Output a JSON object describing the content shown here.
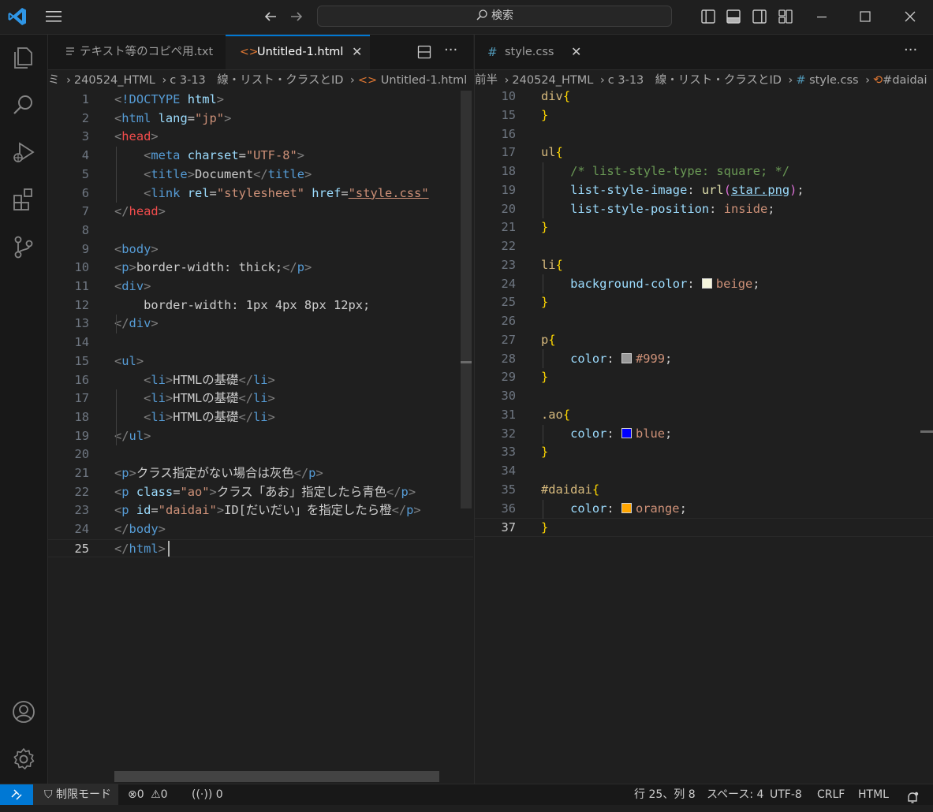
{
  "title_bar": {
    "search_placeholder": "検索"
  },
  "left_editor": {
    "tabs": [
      {
        "label": "テキスト等のコピペ用.txt",
        "active": false
      },
      {
        "label": "Untitled-1.html",
        "active": true
      }
    ],
    "breadcrumb": [
      "240524_HTML",
      "c 3-13　線・リスト・クラスとID",
      "Untitled-1.html",
      "..."
    ],
    "breadcrumb_lead": "ミ",
    "current_line": 25,
    "lines": [
      {
        "n": 1,
        "text": "<!DOCTYPE html>"
      },
      {
        "n": 2,
        "text": "<html lang=\"jp\">"
      },
      {
        "n": 3,
        "text": "<head>"
      },
      {
        "n": 4,
        "text": "    <meta charset=\"UTF-8\">"
      },
      {
        "n": 5,
        "text": "    <title>Document</title>"
      },
      {
        "n": 6,
        "text": "    <link rel=\"stylesheet\" href=\"style.css\""
      },
      {
        "n": 7,
        "text": "</head>"
      },
      {
        "n": 8,
        "text": ""
      },
      {
        "n": 9,
        "text": "<body>"
      },
      {
        "n": 10,
        "text": "<p>border-width: thick;</p>"
      },
      {
        "n": 11,
        "text": "<div>"
      },
      {
        "n": 12,
        "text": "    border-width: 1px 4px 8px 12px;"
      },
      {
        "n": 13,
        "text": "</div>"
      },
      {
        "n": 14,
        "text": ""
      },
      {
        "n": 15,
        "text": "<ul>"
      },
      {
        "n": 16,
        "text": "    <li>HTMLの基礎</li>"
      },
      {
        "n": 17,
        "text": "    <li>HTMLの基礎</li>"
      },
      {
        "n": 18,
        "text": "    <li>HTMLの基礎</li>"
      },
      {
        "n": 19,
        "text": "</ul>"
      },
      {
        "n": 20,
        "text": ""
      },
      {
        "n": 21,
        "text": "<p>クラス指定がない場合は灰色</p>"
      },
      {
        "n": 22,
        "text": "<p class=\"ao\">クラス「あお」指定したら青色</p>"
      },
      {
        "n": 23,
        "text": "<p id=\"daidai\">ID[だいだい」を指定したら橙</p>"
      },
      {
        "n": 24,
        "text": "</body>"
      },
      {
        "n": 25,
        "text": "</html>"
      }
    ]
  },
  "right_editor": {
    "tabs": [
      {
        "label": "style.css",
        "active": false
      }
    ],
    "breadcrumb": [
      "前半",
      "240524_HTML",
      "c 3-13　線・リスト・クラスとID",
      "style.css",
      "#daidai"
    ],
    "current_line": 37,
    "lines": [
      {
        "n": 10,
        "text": "div{"
      },
      {
        "n": 15,
        "text": "}"
      },
      {
        "n": 16,
        "text": ""
      },
      {
        "n": 17,
        "text": "ul{"
      },
      {
        "n": 18,
        "text": "    /* list-style-type: square; */"
      },
      {
        "n": 19,
        "text": "    list-style-image: url(star.png);"
      },
      {
        "n": 20,
        "text": "    list-style-position: inside;"
      },
      {
        "n": 21,
        "text": "}"
      },
      {
        "n": 22,
        "text": ""
      },
      {
        "n": 23,
        "text": "li{"
      },
      {
        "n": 24,
        "text": "    background-color: beige;"
      },
      {
        "n": 25,
        "text": "}"
      },
      {
        "n": 26,
        "text": ""
      },
      {
        "n": 27,
        "text": "p{"
      },
      {
        "n": 28,
        "text": "    color: #999;"
      },
      {
        "n": 29,
        "text": "}"
      },
      {
        "n": 30,
        "text": ""
      },
      {
        "n": 31,
        "text": ".ao{"
      },
      {
        "n": 32,
        "text": "    color: blue;"
      },
      {
        "n": 33,
        "text": "}"
      },
      {
        "n": 34,
        "text": ""
      },
      {
        "n": 35,
        "text": "#daidai{"
      },
      {
        "n": 36,
        "text": "    color: orange;"
      },
      {
        "n": 37,
        "text": "}"
      }
    ],
    "swatches": {
      "beige": "#f5f5dc",
      "gray": "#999999",
      "blue": "#0000ff",
      "orange": "#ffa500"
    }
  },
  "status_bar": {
    "restricted_mode": "制限モード",
    "errors": "0",
    "warnings": "0",
    "ports": "0",
    "position": "行 25、列 8",
    "spaces": "スペース: 4",
    "encoding": "UTF-8",
    "eol": "CRLF",
    "language": "HTML"
  },
  "colors": {
    "accent": "#0078d4",
    "background": "#1f1f1f",
    "sidebar": "#181818"
  }
}
